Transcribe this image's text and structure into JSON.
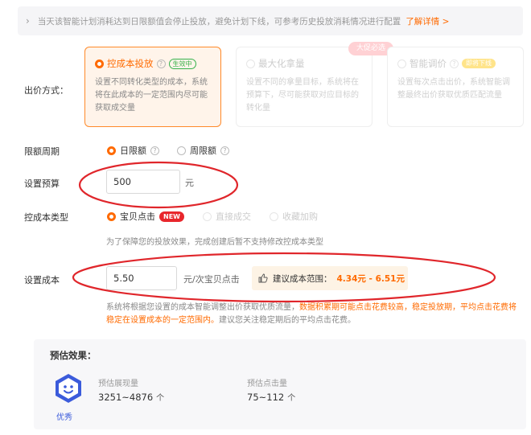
{
  "notice": {
    "text": "当天该智能计划消耗达到日限额值会停止投放，避免计划下线，可参考历史投放消耗情况进行配置",
    "link": "了解详情 >"
  },
  "bid": {
    "label": "出价方式：",
    "hot_badge": "大促必选",
    "cards": [
      {
        "title": "控成本投放",
        "tag": "生效中",
        "desc": "设置不同转化类型的成本，系统将在此成本的一定范围内尽可能获取成交量"
      },
      {
        "title": "最大化拿量",
        "desc": "设置不同的拿量目标，系统将在预算下，尽可能获取对应目标的转化量"
      },
      {
        "title": "智能调价",
        "tag": "即将下线",
        "desc": "设置每次点击出价，系统智能调整最终出价获取优质匹配流量"
      }
    ]
  },
  "limit": {
    "label": "限额周期",
    "options": [
      "日限额",
      "周限额"
    ]
  },
  "budget": {
    "label": "设置预算",
    "value": "500",
    "unit": "元"
  },
  "cost_type": {
    "label": "控成本类型",
    "options": [
      "宝贝点击",
      "直接成交",
      "收藏加购"
    ],
    "new_tag": "NEW",
    "hint": "为了保障您的投放效果，完成创建后暂不支持修改控成本类型"
  },
  "cost": {
    "label": "设置成本",
    "value": "5.50",
    "unit": "元/次宝贝点击",
    "suggest_label": "建议成本范围：",
    "suggest_range": "4.34元 - 6.51元"
  },
  "note": {
    "gray": "系统将根据您设置的成本智能调整出价获取优质流量，",
    "orange": "数据积累期可能点击花费较高，稳定投放期，平均点击花费将稳定在设置成本的一定范围内。",
    "tail": "建议您关注稳定期后的平均点击花费。"
  },
  "estimate": {
    "title": "预估效果：",
    "grade": "优秀",
    "metrics": [
      {
        "title": "预估展现量",
        "value": "3251~4876",
        "unit": "个"
      },
      {
        "title": "预估点击量",
        "value": "75~112",
        "unit": "个"
      }
    ]
  },
  "colors": {
    "accent": "#ff6a00",
    "annotation": "#e0262b",
    "grade": "#3b5bdb"
  }
}
